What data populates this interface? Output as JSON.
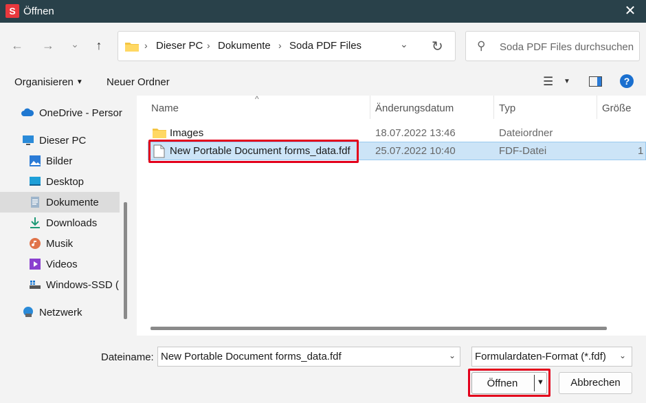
{
  "window": {
    "app_icon_letter": "S",
    "title": "Öffnen",
    "close": "✕"
  },
  "nav": {
    "back": "←",
    "forward": "→",
    "recent": "⌄",
    "up": "↑",
    "breadcrumb": [
      "Dieser PC",
      "Dokumente",
      "Soda PDF Files"
    ],
    "separator": "›",
    "dropdown": "⌄",
    "refresh": "↻",
    "search_placeholder": "Soda PDF Files durchsuchen",
    "search_glyph": "⚲"
  },
  "toolbar": {
    "organize": "Organisieren",
    "organize_caret": "▼",
    "new_folder": "Neuer Ordner",
    "view_glyph": "☰",
    "view_caret": "▼",
    "help": "?"
  },
  "sidebar": {
    "items": [
      {
        "label": "OneDrive - Persor",
        "icon": "cloud-icon"
      },
      {
        "label": "Dieser PC",
        "icon": "monitor-icon"
      },
      {
        "label": "Bilder",
        "icon": "pictures-icon"
      },
      {
        "label": "Desktop",
        "icon": "desktop-icon"
      },
      {
        "label": "Dokumente",
        "icon": "documents-icon",
        "selected": true
      },
      {
        "label": "Downloads",
        "icon": "download-icon"
      },
      {
        "label": "Musik",
        "icon": "music-icon"
      },
      {
        "label": "Videos",
        "icon": "video-icon"
      },
      {
        "label": "Windows-SSD (",
        "icon": "drive-icon"
      },
      {
        "label": "Netzwerk",
        "icon": "network-icon"
      }
    ]
  },
  "files": {
    "sort_glyph": "^",
    "columns": [
      "Name",
      "Änderungsdatum",
      "Typ",
      "Größe"
    ],
    "rows": [
      {
        "name": "Images",
        "date": "18.07.2022 13:46",
        "type": "Dateiordner",
        "size": "",
        "icon": "folder-icon"
      },
      {
        "name": "New Portable Document forms_data.fdf",
        "date": "25.07.2022 10:40",
        "type": "FDF-Datei",
        "size": "1",
        "icon": "file-icon",
        "selected": true
      }
    ]
  },
  "footer": {
    "filename_label": "Dateiname:",
    "filename_value": "New Portable Document forms_data.fdf",
    "filetype_value": "Formulardaten-Format (*.fdf)",
    "chevron": "⌄",
    "open_label": "Öffnen",
    "open_caret": "▼",
    "cancel_label": "Abbrechen"
  },
  "colors": {
    "titlebar": "#29414a",
    "highlight_red": "#e3001b",
    "selection": "#cce4f7",
    "accent": "#1a6fcf"
  }
}
